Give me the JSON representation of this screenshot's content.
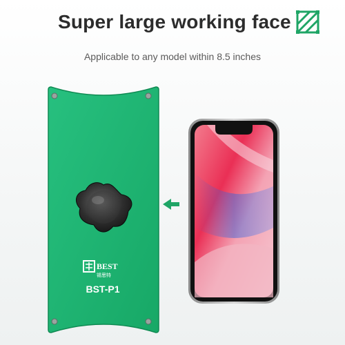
{
  "header": {
    "title": "Super large working face",
    "subtitle": "Applicable to any model within 8.5 inches",
    "title_icon": "diagonal-hatch-square-icon"
  },
  "pad": {
    "brand": "BEST",
    "brand_cn": "锡思特",
    "model": "BST-P1",
    "color": "#1fb573",
    "knob_icon": "star-knob-icon"
  },
  "phone": {
    "type": "smartphone",
    "arrow_icon": "left-arrow-icon"
  },
  "colors": {
    "accent_green": "#1fa566",
    "pad_green": "#1fb573",
    "title_text": "#2c2c2c",
    "subtitle_text": "#5a5a5a"
  }
}
